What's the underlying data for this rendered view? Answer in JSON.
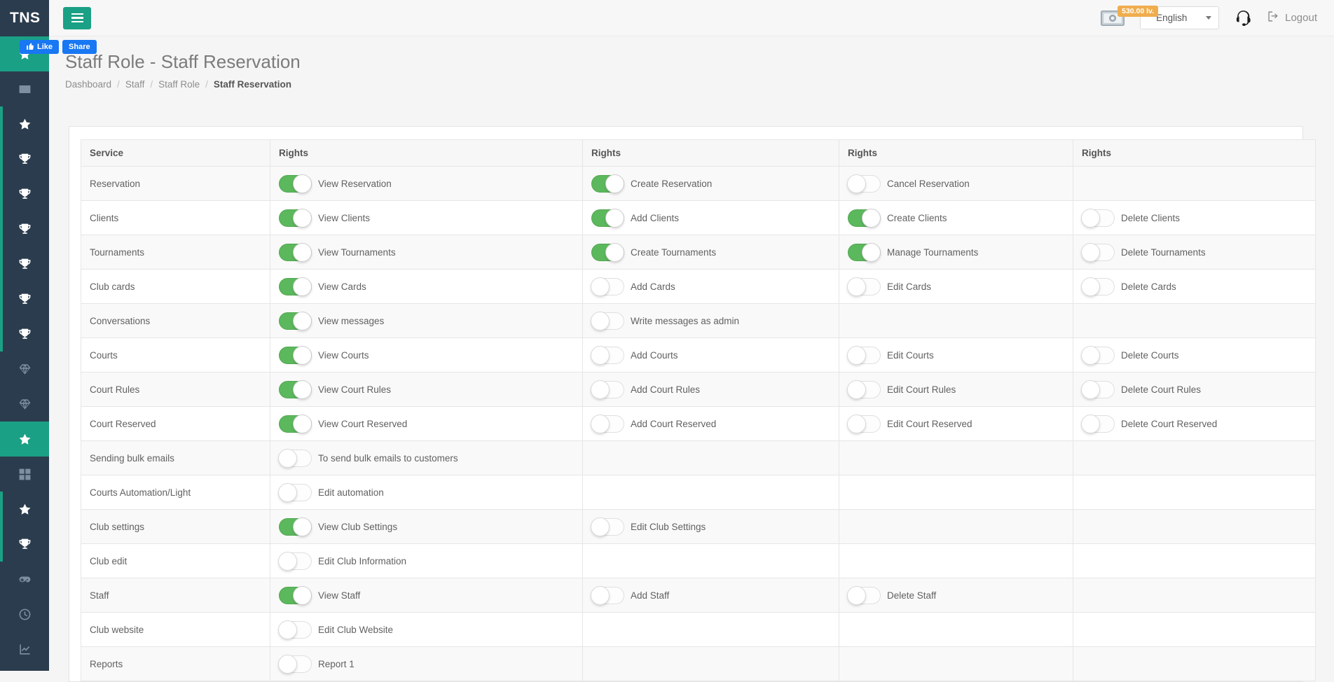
{
  "brand": {
    "name": "TNS"
  },
  "social": [
    {
      "icon": "thumbs-up-icon",
      "label": "Like"
    },
    {
      "icon": "share-icon",
      "label": "Share"
    }
  ],
  "topbar": {
    "menu_toggle_label": "menu-toggle",
    "balance": "530.00 lv.",
    "money_icon": "money-icon",
    "language": "English",
    "support_icon": "headset-icon",
    "logout_label": "Logout",
    "logout_icon": "logout-icon"
  },
  "sidebar": {
    "items": [
      {
        "icon": "star-icon",
        "state": "active"
      },
      {
        "icon": "envelope-icon",
        "state": "dim"
      },
      {
        "icon": "star-icon",
        "state": "grouped"
      },
      {
        "icon": "trophy-icon",
        "state": "grouped"
      },
      {
        "icon": "trophy-icon",
        "state": "grouped"
      },
      {
        "icon": "trophy-icon",
        "state": "grouped"
      },
      {
        "icon": "trophy-icon",
        "state": "grouped"
      },
      {
        "icon": "trophy-icon",
        "state": "grouped"
      },
      {
        "icon": "trophy-icon",
        "state": "grouped"
      },
      {
        "icon": "diamond-icon",
        "state": "dim"
      },
      {
        "icon": "diamond-icon",
        "state": "dim"
      },
      {
        "icon": "star-icon",
        "state": "active"
      },
      {
        "icon": "grid-icon",
        "state": "dim"
      },
      {
        "icon": "star-icon",
        "state": "grouped"
      },
      {
        "icon": "trophy-icon",
        "state": "grouped"
      },
      {
        "icon": "gamepad-icon",
        "state": "dim"
      },
      {
        "icon": "clock-icon",
        "state": "dim"
      },
      {
        "icon": "chart-line-icon",
        "state": "dim"
      }
    ]
  },
  "page": {
    "title": "Staff Role - Staff Reservation",
    "breadcrumb": [
      {
        "label": "Dashboard",
        "active": false
      },
      {
        "label": "Staff",
        "active": false
      },
      {
        "label": "Staff Role",
        "active": false
      },
      {
        "label": "Staff Reservation",
        "active": true
      }
    ],
    "breadcrumb_separator": "/"
  },
  "table": {
    "headers": [
      "Service",
      "Rights",
      "Rights",
      "Rights",
      "Rights"
    ],
    "rows": [
      {
        "service": "Reservation",
        "rights": [
          {
            "label": "View Reservation",
            "on": true
          },
          {
            "label": "Create Reservation",
            "on": true
          },
          {
            "label": "Cancel Reservation",
            "on": false
          },
          null
        ]
      },
      {
        "service": "Clients",
        "rights": [
          {
            "label": "View Clients",
            "on": true
          },
          {
            "label": "Add Clients",
            "on": true
          },
          {
            "label": "Create Clients",
            "on": true
          },
          {
            "label": "Delete Clients",
            "on": false
          }
        ]
      },
      {
        "service": "Tournaments",
        "rights": [
          {
            "label": "View Tournaments",
            "on": true
          },
          {
            "label": "Create Tournaments",
            "on": true
          },
          {
            "label": "Manage Tournaments",
            "on": true
          },
          {
            "label": "Delete Tournaments",
            "on": false
          }
        ]
      },
      {
        "service": "Club cards",
        "rights": [
          {
            "label": "View Cards",
            "on": true
          },
          {
            "label": "Add Cards",
            "on": false
          },
          {
            "label": "Edit Cards",
            "on": false
          },
          {
            "label": "Delete Cards",
            "on": false
          }
        ]
      },
      {
        "service": "Conversations",
        "rights": [
          {
            "label": "View messages",
            "on": true
          },
          {
            "label": "Write messages as admin",
            "on": false
          },
          null,
          null
        ]
      },
      {
        "service": "Courts",
        "rights": [
          {
            "label": "View Courts",
            "on": true
          },
          {
            "label": "Add Courts",
            "on": false
          },
          {
            "label": "Edit Courts",
            "on": false
          },
          {
            "label": "Delete Courts",
            "on": false
          }
        ]
      },
      {
        "service": "Court Rules",
        "rights": [
          {
            "label": "View Court Rules",
            "on": true
          },
          {
            "label": "Add Court Rules",
            "on": false
          },
          {
            "label": "Edit Court Rules",
            "on": false
          },
          {
            "label": "Delete Court Rules",
            "on": false
          }
        ]
      },
      {
        "service": "Court Reserved",
        "rights": [
          {
            "label": "View Court Reserved",
            "on": true
          },
          {
            "label": "Add Court Reserved",
            "on": false
          },
          {
            "label": "Edit Court Reserved",
            "on": false
          },
          {
            "label": "Delete Court Reserved",
            "on": false
          }
        ]
      },
      {
        "service": "Sending bulk emails",
        "rights": [
          {
            "label": "To send bulk emails to customers",
            "on": false
          },
          null,
          null,
          null
        ]
      },
      {
        "service": "Courts Automation/Light",
        "rights": [
          {
            "label": "Edit automation",
            "on": false
          },
          null,
          null,
          null
        ]
      },
      {
        "service": "Club settings",
        "rights": [
          {
            "label": "View Club Settings",
            "on": true
          },
          {
            "label": "Edit Club Settings",
            "on": false
          },
          null,
          null
        ]
      },
      {
        "service": "Club edit",
        "rights": [
          {
            "label": "Edit Club Information",
            "on": false
          },
          null,
          null,
          null
        ]
      },
      {
        "service": "Staff",
        "rights": [
          {
            "label": "View Staff",
            "on": true
          },
          {
            "label": "Add Staff",
            "on": false
          },
          {
            "label": "Delete Staff",
            "on": false
          },
          null
        ]
      },
      {
        "service": "Club website",
        "rights": [
          {
            "label": "Edit Club Website",
            "on": false
          },
          null,
          null,
          null
        ]
      },
      {
        "service": "Reports",
        "rights": [
          {
            "label": "Report 1",
            "on": false
          },
          null,
          null,
          null
        ]
      }
    ]
  },
  "colors": {
    "sidebar": "#2b3c4e",
    "accent": "#1aa085",
    "toggle_on": "#5cb85c",
    "badge": "#f0ad4e",
    "facebook": "#1877f2"
  }
}
